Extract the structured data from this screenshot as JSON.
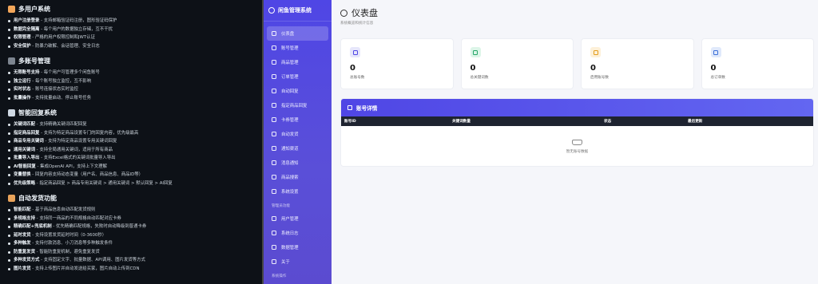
{
  "readme": {
    "sections": [
      {
        "title": "多用户系统",
        "emoji_color": "#f2a65a",
        "items": [
          {
            "bold": "用户注册登录",
            "text": " - 支持邮箱验证码注册，图形验证码保护"
          },
          {
            "bold": "数据完全隔离",
            "text": " - 每个用户的数据独立存储，互不干扰"
          },
          {
            "bold": "权限管理",
            "text": " - 严格的用户权限控制和JWT认证"
          },
          {
            "bold": "安全保护",
            "text": " - 防暴力破解、会话管理、安全日志"
          }
        ]
      },
      {
        "title": "多账号管理",
        "emoji_color": "#7d8590",
        "items": [
          {
            "bold": "无限账号支持",
            "text": " - 每个用户可管理多个闲鱼账号"
          },
          {
            "bold": "独立运行",
            "text": " - 每个账号独立监控，互不影响"
          },
          {
            "bold": "实时状态",
            "text": " - 账号连接状态实时监控"
          },
          {
            "bold": "批量操作",
            "text": " - 支持批量启动、停止账号任务"
          }
        ]
      },
      {
        "title": "智能回复系统",
        "emoji_color": "#cfd8e3",
        "items": [
          {
            "bold": "关键词匹配",
            "text": " - 支持精确关键词匹配回复"
          },
          {
            "bold": "指定商品回复",
            "text": " - 支持为特定商品设置专门的回复内容，优先级最高"
          },
          {
            "bold": "商品专用关键词",
            "text": " - 支持为特定商品设置专用关键词回复"
          },
          {
            "bold": "通用关键词",
            "text": " - 支持全局通用关键词，适用于所有商品"
          },
          {
            "bold": "批量导入导出",
            "text": " - 支持Excel格式的关键词批量导入导出"
          },
          {
            "bold": "AI智能回复",
            "text": " - 集成OpenAI API，支持上下文理解"
          },
          {
            "bold": "变量替换",
            "text": " - 回复内容支持动态变量（用户名、商品信息、商品ID等）"
          },
          {
            "bold": "优先级策略",
            "text": " - 指定商品回复 > 商品专用关键词 > 通用关键词 > 默认回复 > AI回复"
          }
        ]
      },
      {
        "title": "自动发货功能",
        "emoji_color": "#e8a25a",
        "items": [
          {
            "bold": "智能匹配",
            "text": " - 基于商品信息自动匹配发货规则"
          },
          {
            "bold": "多规格支持",
            "text": " - 支持同一商品的不同规格自动匹配对应卡券"
          },
          {
            "bold": "精确匹配+兜底机制",
            "text": " - 优先精确匹配规格，失败时自动降级到普通卡券"
          },
          {
            "bold": "延时发货",
            "text": " - 支持设置发货延时时间（0-3600秒）"
          },
          {
            "bold": "多种触发",
            "text": " - 支持付款消息、小刀消息等多种触发条件"
          },
          {
            "bold": "防重复发货",
            "text": " - 智能防重复机制，避免重复发货"
          },
          {
            "bold": "多种发货方式",
            "text": " - 支持固定文字、批量数据、API调用、图片发货等方式"
          },
          {
            "bold": "图片发货",
            "text": " - 支持上传图片并自动发送给买家，图片自动上传到CDN"
          }
        ]
      }
    ]
  },
  "sidebar": {
    "brand": "闲鱼管理系统",
    "items": [
      {
        "label": "仪表盘",
        "active": true
      },
      {
        "label": "账号管理"
      },
      {
        "label": "商品管理"
      },
      {
        "label": "订单管理"
      },
      {
        "label": "自动回复"
      },
      {
        "label": "指定商品回复"
      },
      {
        "label": "卡券管理"
      },
      {
        "label": "自动发货"
      },
      {
        "label": "通知渠道"
      },
      {
        "label": "消息通知"
      },
      {
        "label": "商品搜索"
      },
      {
        "label": "系统设置"
      }
    ],
    "admin_group": "管理员功能",
    "admin_items": [
      {
        "label": "用户管理"
      },
      {
        "label": "系统日志"
      },
      {
        "label": "数据管理"
      },
      {
        "label": "关于"
      }
    ],
    "bottom_group": "系统操作"
  },
  "header": {
    "title": "仪表盘",
    "subtitle": "系统概览和统计信息"
  },
  "stats": [
    {
      "value": "0",
      "label": "总账号数",
      "icon": "users-icon",
      "color": "#4f46e5",
      "bg": "#e6e6fb"
    },
    {
      "value": "0",
      "label": "总关键词数",
      "icon": "chat-icon",
      "color": "#22a565",
      "bg": "#dcf5e8"
    },
    {
      "value": "0",
      "label": "启用账号数",
      "icon": "pulse-icon",
      "color": "#e39c1b",
      "bg": "#fdf0d8"
    },
    {
      "value": "0",
      "label": "总订单数",
      "icon": "receipt-icon",
      "color": "#3b6fd8",
      "bg": "#e0e9fb"
    }
  ],
  "panel": {
    "title": "账号详情",
    "columns": [
      "账号ID",
      "关键词数量",
      "状态",
      "最后更新"
    ],
    "empty_text": "暂无账号数据"
  }
}
